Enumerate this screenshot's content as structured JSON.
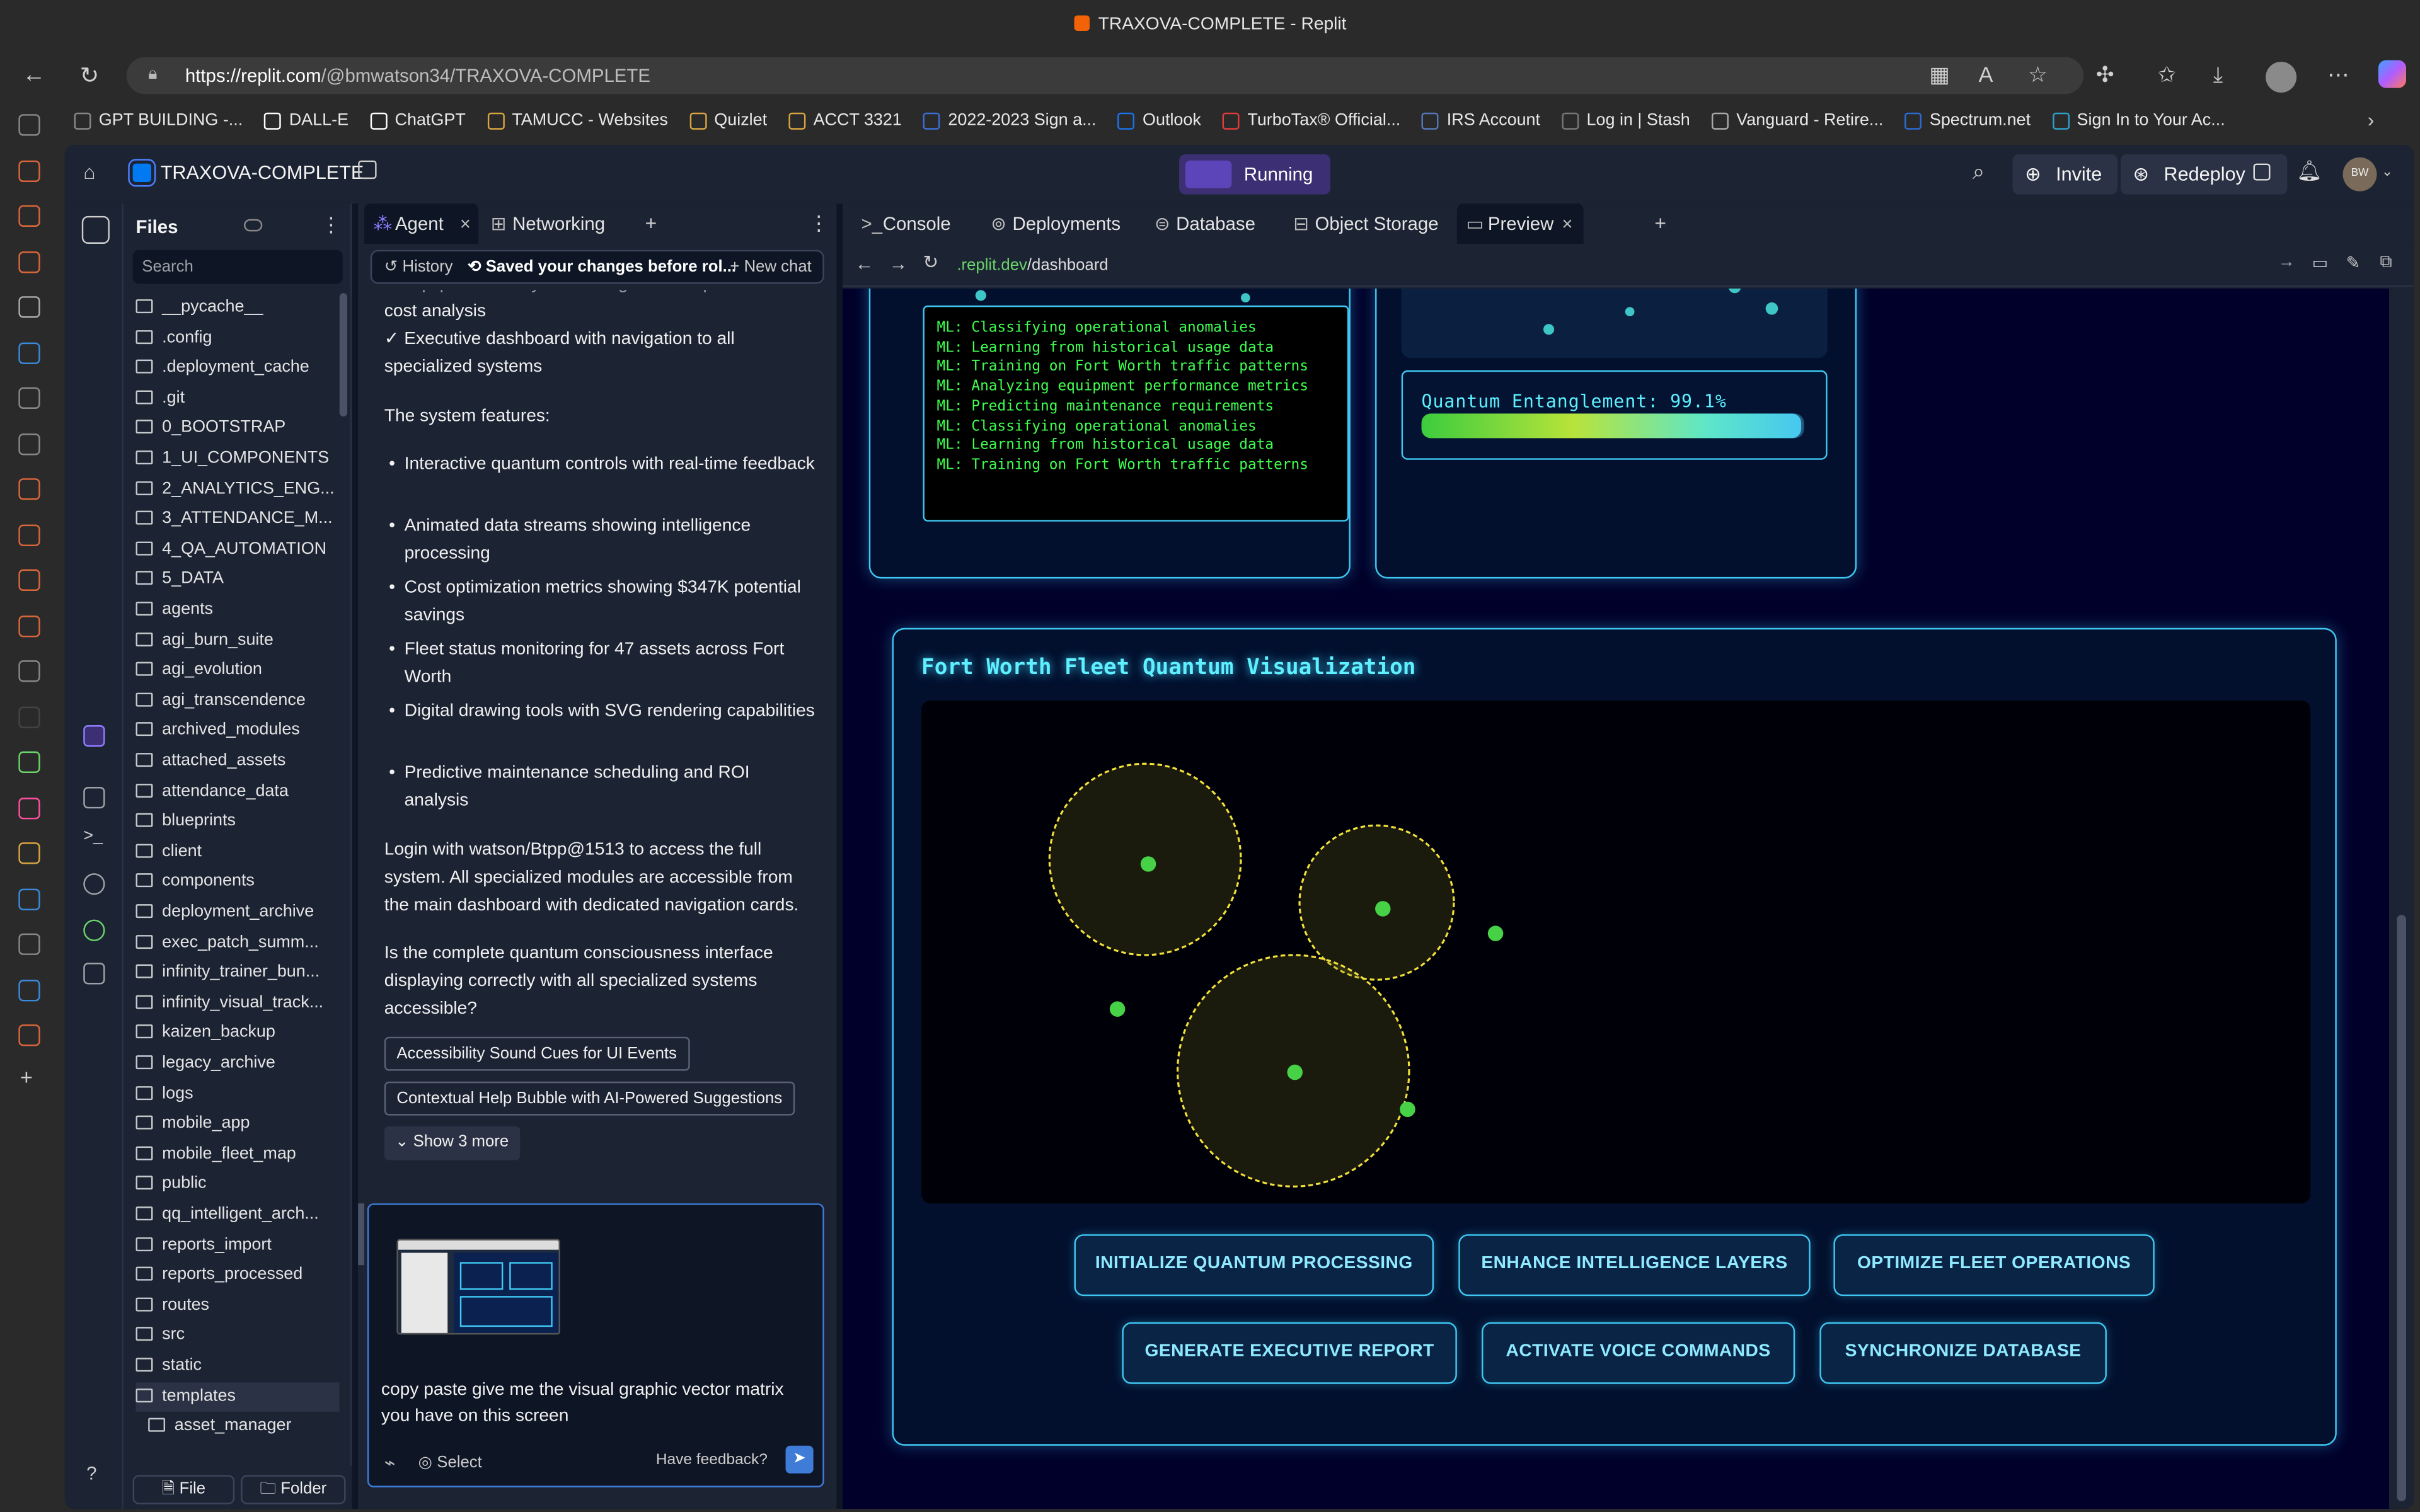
{
  "window": {
    "title": "TRAXOVA-COMPLETE - Replit"
  },
  "browser": {
    "url_host": "https://replit.com",
    "url_path": "/@bmwatson34/TRAXOVA-COMPLETE",
    "bookmarks": [
      "GPT BUILDING -...",
      "DALL-E",
      "ChatGPT",
      "TAMUCC - Websites",
      "Quizlet",
      "ACCT 3321",
      "2022-2023 Sign a...",
      "Outlook",
      "TurboTax® Official...",
      "IRS Account",
      "Log in | Stash",
      "Vanguard - Retire...",
      "Spectrum.net",
      "Sign In to Your Ac..."
    ]
  },
  "replit": {
    "project": "TRAXOVA-COMPLETE",
    "status": "Running",
    "invite": "Invite",
    "redeploy": "Redeploy",
    "avatar": "BW"
  },
  "files": {
    "title": "Files",
    "search_placeholder": "Search",
    "items": [
      "__pycache__",
      ".config",
      ".deployment_cache",
      ".git",
      "0_BOOTSTRAP",
      "1_UI_COMPONENTS",
      "2_ANALYTICS_ENG...",
      "3_ATTENDANCE_M...",
      "4_QA_AUTOMATION",
      "5_DATA",
      "agents",
      "agi_burn_suite",
      "agi_evolution",
      "agi_transcendence",
      "archived_modules",
      "attached_assets",
      "attendance_data",
      "blueprints",
      "client",
      "components",
      "deployment_archive",
      "exec_patch_summ...",
      "infinity_trainer_bun...",
      "infinity_visual_track...",
      "kaizen_backup",
      "legacy_archive",
      "logs",
      "mobile_app",
      "mobile_fleet_map",
      "public",
      "qq_intelligent_arch...",
      "reports_import",
      "reports_processed",
      "routes",
      "src",
      "static",
      "templates",
      "asset_manager"
    ],
    "file_button": "File",
    "folder_button": "Folder"
  },
  "agent": {
    "tabs": [
      "Agent",
      "Networking"
    ],
    "history": "History",
    "saved": "Saved your changes before rol...",
    "new_chat": "New chat",
    "cut_line": "✓ Equipment Lifecycle Costing with comprehensive",
    "line1": "cost analysis",
    "line2": "✓ Executive dashboard with navigation to all specialized systems",
    "features_heading": "The system features:",
    "features": [
      "Interactive quantum controls with real-time feedback",
      "Animated data streams showing intelligence processing",
      "Cost optimization metrics showing $347K potential savings",
      "Fleet status monitoring for 47 assets across Fort Worth",
      "Digital drawing tools with SVG rendering capabilities",
      "Predictive maintenance scheduling and ROI analysis"
    ],
    "login_text": "Login with watson/Btpp@1513 to access the full system. All specialized modules are accessible from the main dashboard with dedicated navigation cards.",
    "question": "Is the complete quantum consciousness interface displaying correctly with all specialized systems accessible?",
    "suggestions": [
      "Accessibility Sound Cues for UI Events",
      "Contextual Help Bubble with AI-Powered Suggestions"
    ],
    "show_more": "Show 3 more",
    "input_text": "copy paste give me the visual graphic vector matrix you have on this screen",
    "select": "Select",
    "feedback": "Have feedback?"
  },
  "preview": {
    "tabs": [
      "Console",
      "Deployments",
      "Database",
      "Object Storage",
      "Preview"
    ],
    "url_host": ".replit.dev",
    "url_path": "/dashboard",
    "ml_log": [
      "ML: Classifying operational anomalies",
      "ML: Learning from historical usage data",
      "ML: Training on Fort Worth traffic patterns",
      "ML: Analyzing equipment performance metrics",
      "ML: Predicting maintenance requirements",
      "ML: Classifying operational anomalies",
      "ML: Learning from historical usage data",
      "ML: Training on Fort Worth traffic patterns"
    ],
    "entanglement_label": "Quantum Entanglement: 99.1%",
    "entanglement_value": 0.991,
    "fleet_title": "Fort Worth Fleet Quantum Visualization",
    "buttons_row1": [
      "INITIALIZE QUANTUM PROCESSING",
      "ENHANCE INTELLIGENCE LAYERS",
      "OPTIMIZE FLEET OPERATIONS"
    ],
    "buttons_row2": [
      "GENERATE EXECUTIVE REPORT",
      "ACTIVATE VOICE COMMANDS",
      "SYNCHRONIZE DATABASE"
    ]
  },
  "colors": {
    "accent": "#3fc7f2",
    "terminal_green": "#3fff4f",
    "bg": "#00002a"
  }
}
